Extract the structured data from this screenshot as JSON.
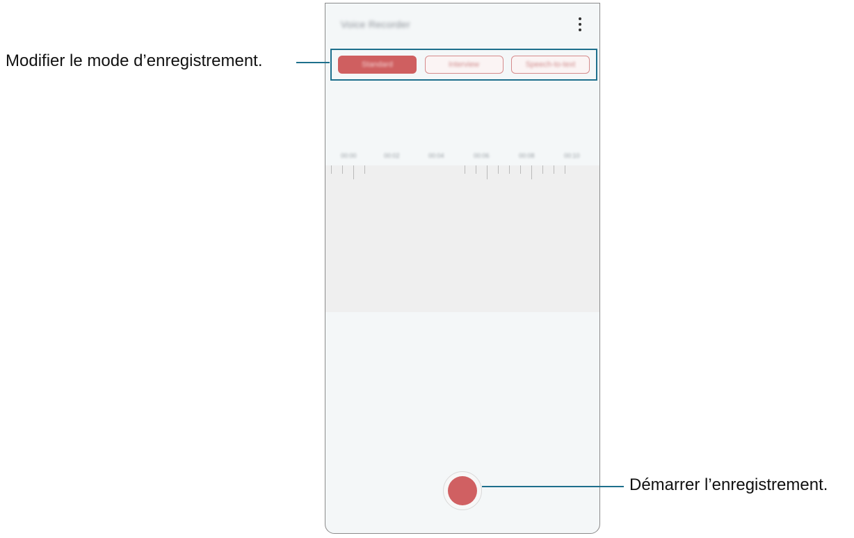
{
  "app": {
    "title": "Voice Recorder",
    "more_icon": "more-options-icon"
  },
  "modes": [
    {
      "label": "Standard",
      "active": true
    },
    {
      "label": "Interview",
      "active": false
    },
    {
      "label": "Speech-to-text",
      "active": false
    }
  ],
  "timeline": {
    "labels": [
      "00:00",
      "00:02",
      "00:04",
      "00:06",
      "00:08",
      "00:10"
    ]
  },
  "record": {
    "icon": "record-icon",
    "color": "#d06062"
  },
  "callouts": {
    "mode": "Modifier le mode d’enregistrement.",
    "record": "Démarrer l’enregistrement."
  },
  "colors": {
    "accent": "#cf5f60",
    "callout_line": "#1d6f8c"
  }
}
